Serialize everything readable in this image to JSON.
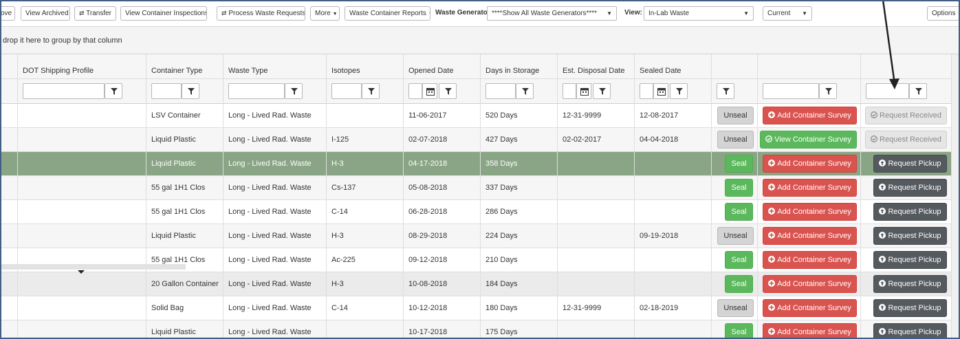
{
  "toolbar": {
    "remove_label": "ove",
    "view_archived": "View Archived",
    "transfer": "Transfer",
    "view_inspections": "View Container Inspections",
    "process_requests": "Process Waste Requests",
    "more": "More",
    "reports": "Waste Container Reports",
    "generator_label": "Waste Generator:",
    "generator_value": "****Show All Waste Generators****",
    "view_label": "View:",
    "view_value": "In-Lab Waste",
    "period_value": "Current",
    "options": "Options"
  },
  "group_panel": {
    "text": "drop it here to group by that column"
  },
  "columns": {
    "dot": "DOT Shipping Profile",
    "container_type": "Container Type",
    "waste_type": "Waste Type",
    "isotopes": "Isotopes",
    "opened": "Opened Date",
    "days": "Days in Storage",
    "est": "Est. Disposal Date",
    "sealed": "Sealed Date"
  },
  "rows": [
    {
      "container_type": "LSV Container",
      "waste_type": "Long - Lived Rad. Waste",
      "isotopes": "",
      "opened": "11-06-2017",
      "days": "520 Days",
      "est": "12-31-9999",
      "sealed": "12-08-2017",
      "seal_action": "Unseal",
      "survey": "Add Container Survey",
      "pickup": "Request Received"
    },
    {
      "container_type": "Liquid Plastic",
      "waste_type": "Long - Lived Rad. Waste",
      "isotopes": "I-125",
      "opened": "02-07-2018",
      "days": "427 Days",
      "est": "02-02-2017",
      "sealed": "04-04-2018",
      "seal_action": "Unseal",
      "survey": "View Container Survey",
      "pickup": "Request Received"
    },
    {
      "container_type": "Liquid Plastic",
      "waste_type": "Long - Lived Rad. Waste",
      "isotopes": "H-3",
      "opened": "04-17-2018",
      "days": "358 Days",
      "est": "",
      "sealed": "",
      "seal_action": "Seal",
      "survey": "Add Container Survey",
      "pickup": "Request Pickup"
    },
    {
      "container_type": "55 gal 1H1 Clos",
      "waste_type": "Long - Lived Rad. Waste",
      "isotopes": "Cs-137",
      "opened": "05-08-2018",
      "days": "337 Days",
      "est": "",
      "sealed": "",
      "seal_action": "Seal",
      "survey": "Add Container Survey",
      "pickup": "Request Pickup"
    },
    {
      "container_type": "55 gal 1H1 Clos",
      "waste_type": "Long - Lived Rad. Waste",
      "isotopes": "C-14",
      "opened": "06-28-2018",
      "days": "286 Days",
      "est": "",
      "sealed": "",
      "seal_action": "Seal",
      "survey": "Add Container Survey",
      "pickup": "Request Pickup"
    },
    {
      "container_type": "Liquid Plastic",
      "waste_type": "Long - Lived Rad. Waste",
      "isotopes": "H-3",
      "opened": "08-29-2018",
      "days": "224 Days",
      "est": "",
      "sealed": "09-19-2018",
      "seal_action": "Unseal",
      "survey": "Add Container Survey",
      "pickup": "Request Pickup"
    },
    {
      "container_type": "55 gal 1H1 Clos",
      "waste_type": "Long - Lived Rad. Waste",
      "isotopes": "Ac-225",
      "opened": "09-12-2018",
      "days": "210 Days",
      "est": "",
      "sealed": "",
      "seal_action": "Seal",
      "survey": "Add Container Survey",
      "pickup": "Request Pickup"
    },
    {
      "container_type": "20 Gallon Container",
      "waste_type": "Long - Lived Rad. Waste",
      "isotopes": "H-3",
      "opened": "10-08-2018",
      "days": "184 Days",
      "est": "",
      "sealed": "",
      "seal_action": "Seal",
      "survey": "Add Container Survey",
      "pickup": "Request Pickup"
    },
    {
      "container_type": "Solid Bag",
      "waste_type": "Long - Lived Rad. Waste",
      "isotopes": "C-14",
      "opened": "10-12-2018",
      "days": "180 Days",
      "est": "12-31-9999",
      "sealed": "02-18-2019",
      "seal_action": "Unseal",
      "survey": "Add Container Survey",
      "pickup": "Request Pickup"
    },
    {
      "container_type": "Liquid Plastic",
      "waste_type": "Long - Lived Rad. Waste",
      "isotopes": "",
      "opened": "10-17-2018",
      "days": "175 Days",
      "est": "",
      "sealed": "",
      "seal_action": "Seal",
      "survey": "Add Container Survey",
      "pickup": "Request Pickup"
    }
  ],
  "row_states": {
    "selected_row": 2,
    "hover_row": 7
  },
  "colors": {
    "selected_row": "#8aa585",
    "seal_green": "#5cb85c",
    "survey_red": "#d9534f",
    "pickup_dark": "#555a5f",
    "frame_blue": "#3f5f86"
  },
  "icons": {
    "transfer": "transfer-arrows-icon",
    "process": "transfer-arrows-icon",
    "filter": "filter-funnel-icon",
    "calendar": "calendar-icon",
    "add": "plus-circle-icon",
    "view": "check-circle-icon",
    "received": "check-circle-icon",
    "pickup": "arrow-up-circle-icon"
  }
}
